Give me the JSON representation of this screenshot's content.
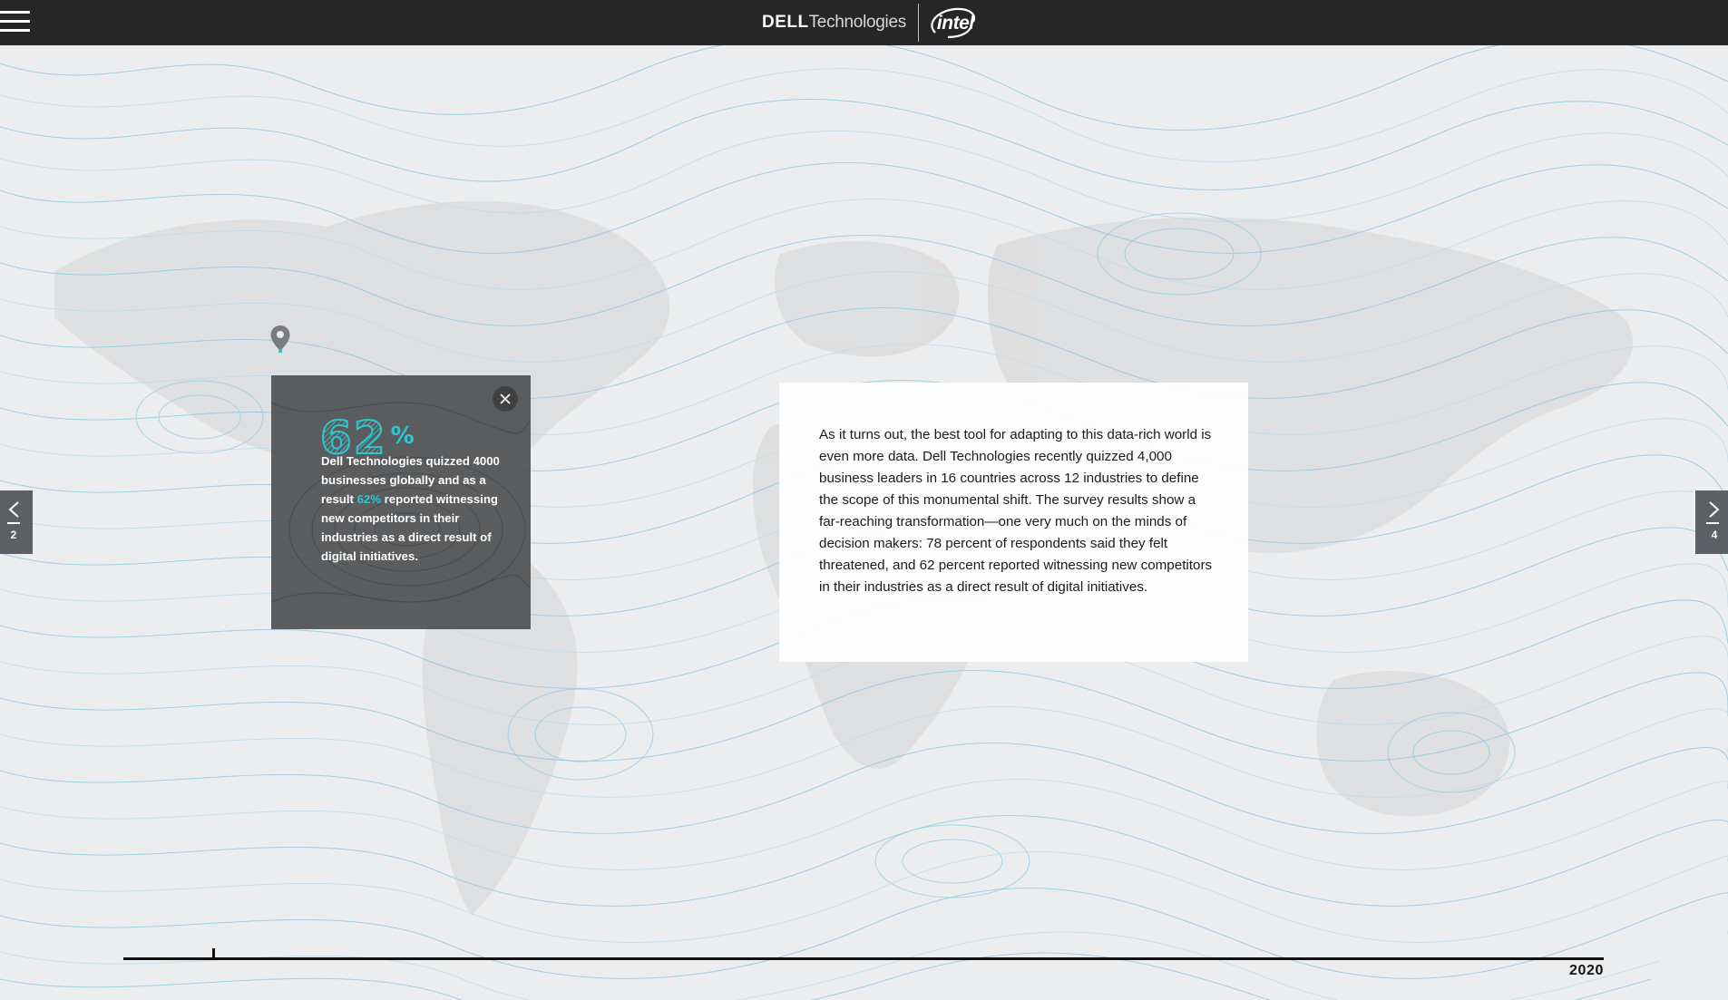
{
  "header": {
    "menu_icon": "hamburger-menu-icon",
    "dell_brand": "DELL",
    "dell_suffix": "Technologies",
    "intel_brand": "intel"
  },
  "nav": {
    "prev": {
      "icon": "chevron-left-icon",
      "label": "2"
    },
    "next": {
      "icon": "chevron-right-icon",
      "label": "4"
    }
  },
  "map": {
    "pin_icon": "map-pin-icon"
  },
  "stat_popup": {
    "value": "62",
    "unit": "%",
    "text_before": "Dell Technologies quizzed 4000 businesses globally and as a result",
    "highlight": "62%",
    "text_after": "reported witnessing new competitors in their industries as a direct result of digital initiatives.",
    "close_icon": "close-icon"
  },
  "info_card": {
    "body": "As it turns out, the best tool for adapting to this data-rich world is even more data. Dell Technologies recently quizzed 4,000 business leaders in 16 countries across 12 industries to define the scope of this monumental shift. The survey results show a far-reaching transformation—one very much on the minds of decision makers: 78 percent of respondents said they felt threatened, and 62 percent reported witnessing new competitors in their industries as a direct result of digital initiatives."
  },
  "timeline": {
    "end_year": "2020"
  },
  "colors": {
    "accent": "#2fc6cf",
    "topbar": "#262626",
    "contour": "#7cc3da"
  }
}
